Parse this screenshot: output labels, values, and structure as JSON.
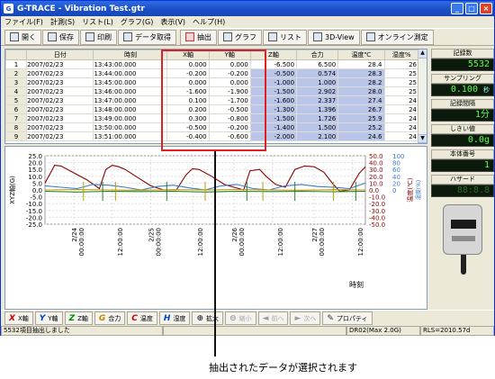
{
  "window": {
    "title": "G-TRACE - Vibration Test.gtr",
    "min": "_",
    "max": "□",
    "close": "×"
  },
  "menu": [
    "ファイル(F)",
    "計測(S)",
    "リスト(L)",
    "グラフ(G)",
    "表示(V)",
    "ヘルプ(H)"
  ],
  "toolbar": [
    "開く",
    "保存",
    "印刷",
    "データ取得",
    "抽出",
    "グラフ",
    "リスト",
    "3D-View",
    "オンライン測定"
  ],
  "table": {
    "headers": [
      "",
      "日付",
      "時刻",
      "X軸",
      "Y軸",
      "Z軸",
      "合力",
      "温度℃",
      "湿度%"
    ],
    "rows": [
      [
        "1",
        "2007/02/23",
        "13:43:00.000",
        "0.000",
        "0.000",
        "-6.500",
        "6.500",
        "28.4",
        "26"
      ],
      [
        "2",
        "2007/02/23",
        "13:44:00.000",
        "-0.200",
        "-0.200",
        "-0.500",
        "0.574",
        "28.3",
        "25"
      ],
      [
        "3",
        "2007/02/23",
        "13:45:00.000",
        "0.000",
        "0.000",
        "-1.000",
        "1.000",
        "28.2",
        "25"
      ],
      [
        "4",
        "2007/02/23",
        "13:46:00.000",
        "-1.600",
        "-1.900",
        "-1.500",
        "2.902",
        "28.0",
        "25"
      ],
      [
        "5",
        "2007/02/23",
        "13:47:00.000",
        "0.100",
        "-1.700",
        "-1.600",
        "2.337",
        "27.4",
        "24"
      ],
      [
        "6",
        "2007/02/23",
        "13:48:00.000",
        "0.200",
        "-0.500",
        "-1.300",
        "1.396",
        "26.7",
        "24"
      ],
      [
        "7",
        "2007/02/23",
        "13:49:00.000",
        "0.300",
        "-0.800",
        "-1.500",
        "1.726",
        "25.9",
        "24"
      ],
      [
        "8",
        "2007/02/23",
        "13:50:00.000",
        "-0.500",
        "-0.200",
        "-1.400",
        "1.500",
        "25.2",
        "24"
      ],
      [
        "9",
        "2007/02/23",
        "13:51:00.000",
        "-0.400",
        "-0.600",
        "-2.000",
        "2.100",
        "24.6",
        "24"
      ]
    ]
  },
  "side": {
    "count_label": "記録数",
    "count_value": "5532",
    "sampling_label": "サンプリング",
    "sampling_value": "0.100",
    "sampling_unit": "秒",
    "interval_label": "記録間隔",
    "interval_value": "1分",
    "threshold_label": "しきい値",
    "threshold_value": "0.0g",
    "serial_label": "本体番号",
    "serial_value": "1",
    "hazard_label": "ハザード",
    "hazard_value": "88:8.8"
  },
  "bottom_buttons": [
    {
      "letter": "X",
      "label": "X軸",
      "color": "#cc0000"
    },
    {
      "letter": "Y",
      "label": "Y軸",
      "color": "#0044cc"
    },
    {
      "letter": "Z",
      "label": "Z軸",
      "color": "#008800"
    },
    {
      "letter": "G",
      "label": "合力",
      "color": "#bb8800"
    },
    {
      "letter": "C",
      "label": "温度",
      "color": "#cc0000"
    },
    {
      "letter": "H",
      "label": "湿度",
      "color": "#0044cc"
    },
    {
      "letter": "⊕",
      "label": "拡大",
      "color": "#333333"
    },
    {
      "letter": "⊖",
      "label": "縮小",
      "color": "#999999"
    },
    {
      "letter": "◄",
      "label": "前へ",
      "color": "#999999"
    },
    {
      "letter": "►",
      "label": "次へ",
      "color": "#999999"
    },
    {
      "letter": "✎",
      "label": "プロパティ",
      "color": "#333333"
    }
  ],
  "status": {
    "left": "5532項目抽出しました",
    "middle": "DR02(Max 2.0G)",
    "right": "RLS=2010.57d"
  },
  "callout": "抽出されたデータが選択されます",
  "chart_data": {
    "type": "line",
    "y_left": {
      "label": "XYZ軸(G)",
      "ticks": [
        "25.0",
        "20.0",
        "15.0",
        "10.0",
        "5.0",
        "0.0",
        "-5.0",
        "-10.0",
        "-15.0",
        "-20.0",
        "-25.0"
      ],
      "range": [
        -25,
        25
      ]
    },
    "y_right_temp": {
      "label": "温度(℃)",
      "ticks": [
        "50.0",
        "40.0",
        "30.0",
        "20.0",
        "10.0",
        "0.0",
        "-10.0",
        "-20.0",
        "-30.0",
        "-40.0",
        "-50.0"
      ],
      "range": [
        -50,
        50
      ]
    },
    "y_right_humid": {
      "label": "湿度(%)",
      "ticks": [
        "100",
        "80",
        "60",
        "40",
        "20",
        "0"
      ],
      "range": [
        0,
        100
      ]
    },
    "x_ticks": [
      {
        "date": "2/24",
        "time": "00:00:00"
      },
      {
        "date": "",
        "time": "12:00:00"
      },
      {
        "date": "2/25",
        "time": "00:00:00"
      },
      {
        "date": "",
        "time": "12:00:00"
      },
      {
        "date": "2/26",
        "time": "00:00:00"
      },
      {
        "date": "",
        "time": "12:00:00"
      },
      {
        "date": "2/27",
        "time": "00:00:00"
      },
      {
        "date": "",
        "time": "12:00:00"
      }
    ],
    "x_label": "時刻",
    "x_range": [
      0,
      100
    ],
    "x_tick_values": [
      9,
      21,
      33,
      46,
      59,
      71,
      84,
      96
    ],
    "series": [
      {
        "name": "温度",
        "color": "#8b0000",
        "axis": "temp",
        "x": [
          0,
          3,
          5,
          9,
          13,
          17,
          19,
          21,
          23,
          25,
          29,
          33,
          37,
          41,
          44,
          46,
          48,
          52,
          56,
          59,
          62,
          64,
          67,
          69,
          72,
          75,
          78,
          81,
          84,
          87,
          90,
          92,
          95,
          98,
          100
        ],
        "y": [
          10,
          36,
          35,
          25,
          15,
          2,
          30,
          36,
          34,
          30,
          18,
          6,
          0,
          0,
          22,
          31,
          30,
          20,
          8,
          4,
          0,
          28,
          30,
          20,
          8,
          4,
          30,
          35,
          34,
          26,
          8,
          -2,
          0,
          24,
          34
        ]
      },
      {
        "name": "湿度",
        "color": "#3a7ac8",
        "axis": "humid",
        "x": [
          0,
          5,
          10,
          15,
          20,
          25,
          30,
          35,
          40,
          45,
          50,
          55,
          60,
          65,
          70,
          75,
          80,
          85,
          90,
          95,
          100
        ],
        "y": [
          56,
          54,
          52,
          58,
          57,
          54,
          50,
          55,
          57,
          53,
          50,
          56,
          58,
          52,
          50,
          56,
          58,
          55,
          54,
          52,
          60
        ]
      },
      {
        "name": "Z軸",
        "color": "#2e7d2e",
        "axis": "left",
        "x": [
          0,
          10,
          20,
          30,
          40,
          50,
          60,
          70,
          80,
          90,
          100
        ],
        "y": [
          -1,
          -1.5,
          -1,
          -1.2,
          -1,
          -1.5,
          -1,
          -1.2,
          -1,
          -1.3,
          -1
        ]
      },
      {
        "name": "X軸",
        "color": "#b8a000",
        "axis": "left",
        "x": [
          0,
          10,
          20,
          30,
          40,
          50,
          60,
          70,
          80,
          90,
          100
        ],
        "y": [
          0,
          0.3,
          0,
          -0.2,
          0.2,
          0,
          0.3,
          0,
          -0.2,
          0.2,
          0
        ]
      }
    ]
  }
}
